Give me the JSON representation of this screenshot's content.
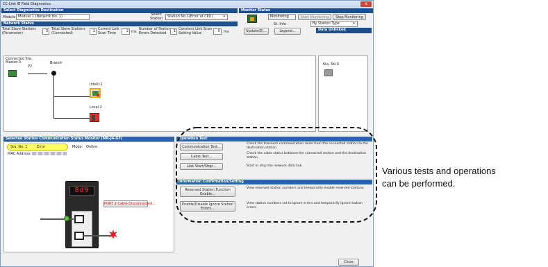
{
  "window": {
    "title": "CC-Link IE Field Diagnostics",
    "close_glyph": "x"
  },
  "select_section": {
    "header": "Select Diagnostics Destination",
    "module_label": "Module",
    "module_value": "Module 1 (Network No. 1)",
    "select_station_label": "Select Station",
    "select_station_value": "Station No.1(Error at CPU)"
  },
  "monitor_status": {
    "header": "Monitor Status",
    "monitoring_label": "Monitoring",
    "start_button": "Start Monitoring",
    "stop_button": "Stop Monitoring",
    "st_info_label": "St. Info",
    "st_info_value": "By Station Type",
    "update_button": "Update(E)...",
    "legend_button": "Legend...",
    "data_unlinked": "Data Unlinked"
  },
  "network_status": {
    "header": "Network Status",
    "total_param_label": "Total Slave Stations (Parameter)",
    "total_param_value": "3",
    "total_conn_label": "Total Slave Stations (Connected)",
    "total_conn_value": "2",
    "scan_label": "Current Link Scan Time",
    "scan_value": "2",
    "scan_unit": "ms",
    "errors_label": "Number of Station Errors Detected",
    "errors_value": "1",
    "const_label": "Constant Link Scan Setting Value",
    "const_value": "0",
    "const_unit": "ms"
  },
  "topology": {
    "connected_label": "Connected Sta.",
    "master_label": "Master:0",
    "port_label": "P2",
    "branch_label": "Branch",
    "intelli_label": "Intelli:1",
    "local_label": "Local:2",
    "side_station_label": "Sta. No.0"
  },
  "station_monitor": {
    "header": "Selected Station Communication Status Monitor (MR-J4-GF)",
    "sta_no": "Sta. No. 1",
    "status": "Error",
    "mode_label": "Mode:",
    "mode_value": "Online",
    "mac_label": "MAC Address:",
    "display_text": "8d9",
    "port_button": "PORT 2 Cable Disconnected..."
  },
  "operation_test": {
    "header": "Operation Test",
    "items": [
      {
        "button": "Communication Test...",
        "desc": "Check the transient communication route from the connected station to the destination station."
      },
      {
        "button": "Cable Test...",
        "desc": "Check the cable status between the connected station and the destination station."
      },
      {
        "button": "Link Start/Stop...",
        "desc": "Start or stop the network data link."
      }
    ]
  },
  "info_confirmation": {
    "header": "Information Confirmation/Setting",
    "items": [
      {
        "button": "Reserved Station Function Enable...",
        "desc": "View reserved station numbers and temporarily enable reserved stations."
      },
      {
        "button": "Enable/Disable Ignore Station Errors...",
        "desc": "View station numbers set to ignore errors and temporarily ignore station errors."
      }
    ]
  },
  "footer": {
    "close_button": "Close"
  },
  "annotation": {
    "line1": "Various tests and operations",
    "line2": "can be performed."
  },
  "colors": {
    "header_blue": "#1f4e8c",
    "error_yellow": "#ffff66",
    "callout_red": "#e02020"
  }
}
